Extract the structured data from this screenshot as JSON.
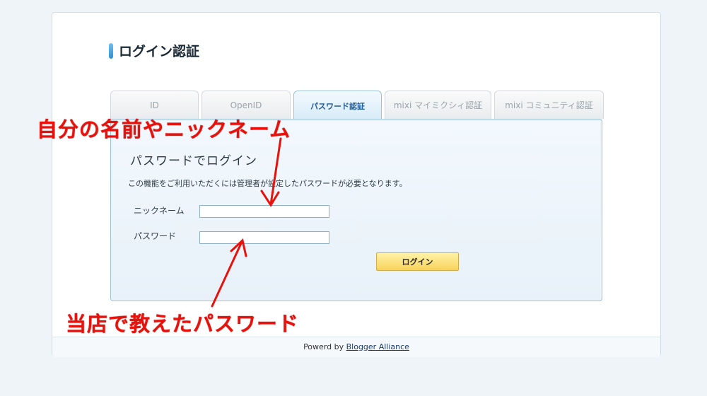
{
  "page_title": "ログイン認証",
  "tabs": [
    {
      "label": "ID",
      "active": false
    },
    {
      "label": "OpenID",
      "active": false
    },
    {
      "label": "パスワード認証",
      "active": true
    },
    {
      "label": "mixi マイミクシィ認証",
      "active": false
    },
    {
      "label": "mixi コミュニティ認証",
      "active": false
    }
  ],
  "panel": {
    "heading": "パスワードでログイン",
    "description": "この機能をご利用いただくには管理者が設定したパスワードが必要となります。",
    "nickname_label": "ニックネーム",
    "nickname_value": "",
    "password_label": "パスワード",
    "password_value": "",
    "login_button": "ログイン"
  },
  "footer": {
    "prefix": "Powerd by",
    "link": "Blogger Alliance"
  },
  "annotations": {
    "nickname_note": "自分の名前やニックネーム",
    "password_note": "当店で教えたパスワード"
  },
  "colors": {
    "accent": "#2f8fd0",
    "annotation": "#e8120c",
    "button": "#f7d25a"
  }
}
